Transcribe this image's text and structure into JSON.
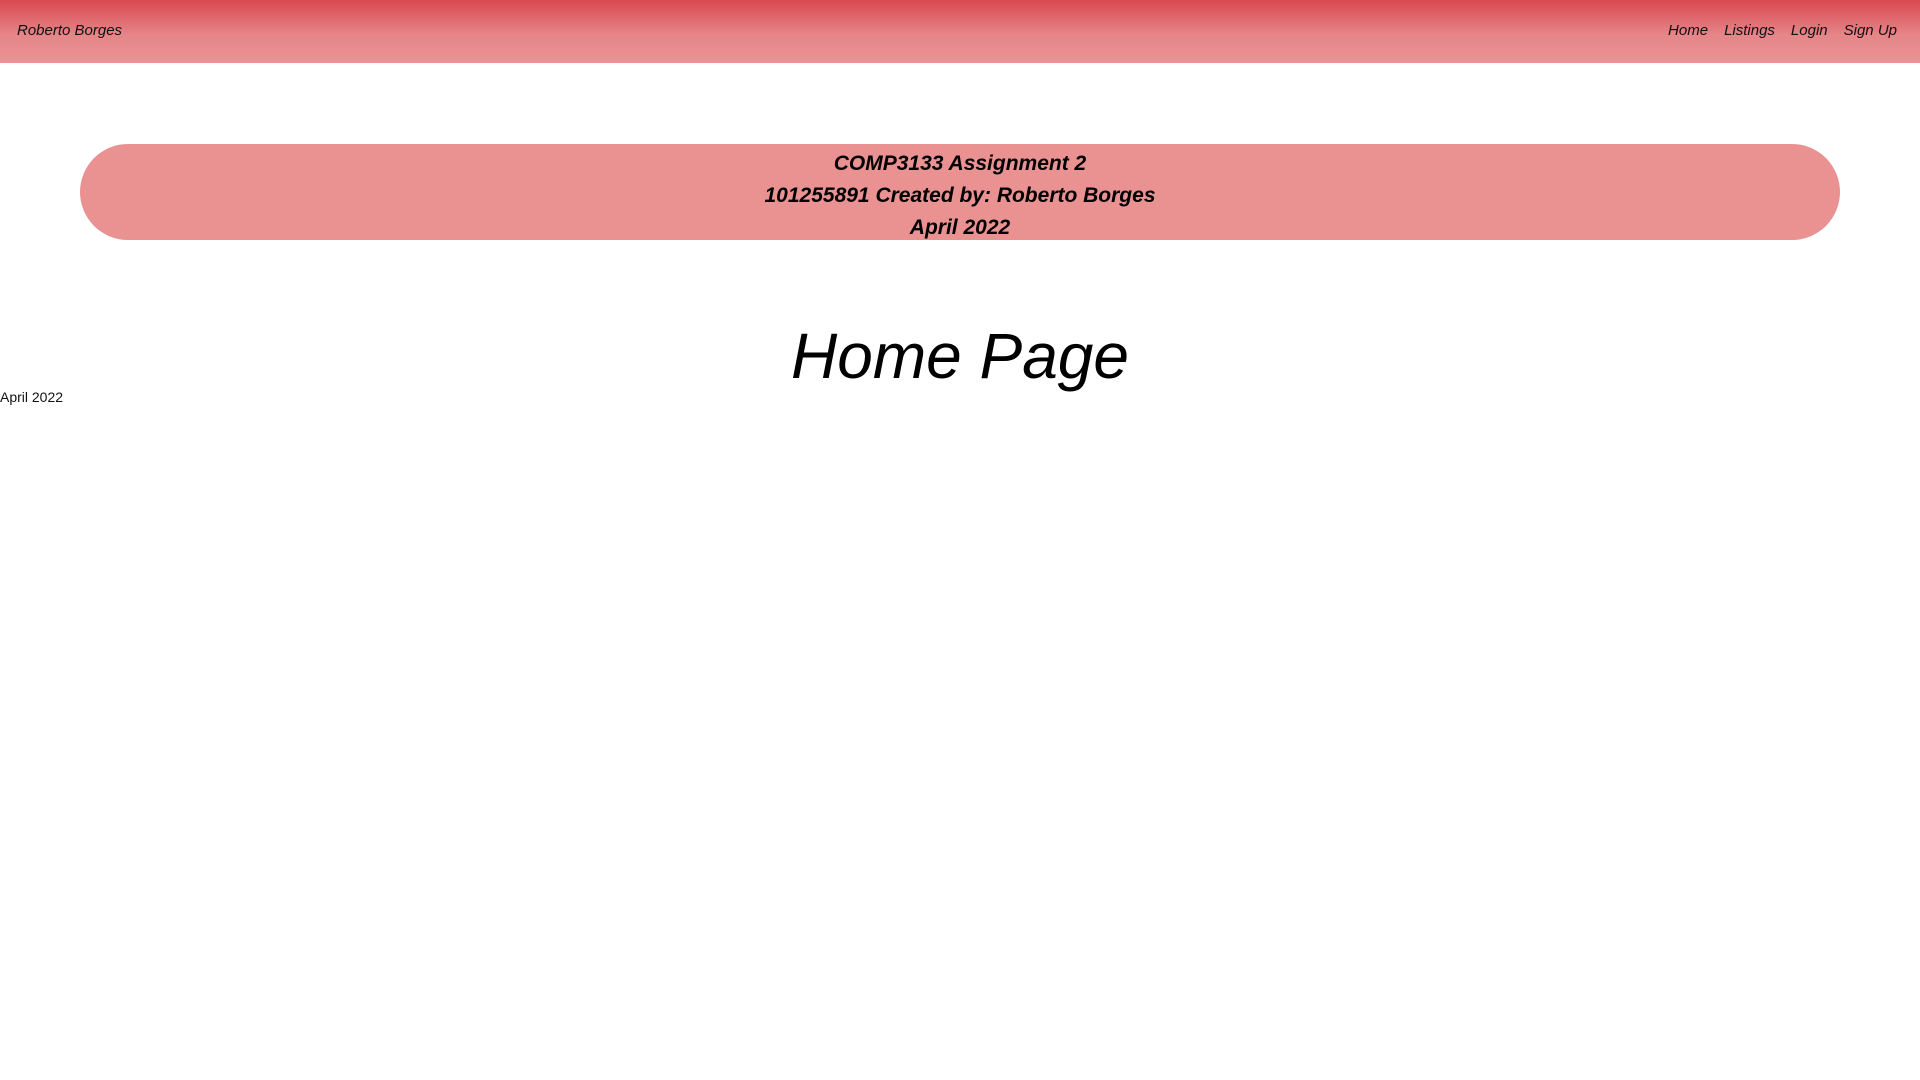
{
  "navbar": {
    "brand": "Roberto Borges",
    "links": [
      "Home",
      "Listings",
      "Login",
      "Sign Up"
    ],
    "gradient_top": "#d9494f",
    "gradient_bottom": "#ea9295"
  },
  "banner": {
    "line1": "COMP3133 Assignment 2",
    "line2": "101255891 Created by: Roberto Borges",
    "line3": "April 2022",
    "background": "#ea9192"
  },
  "main": {
    "heading": "Home Page"
  },
  "footer": {
    "text": "April 2022"
  }
}
